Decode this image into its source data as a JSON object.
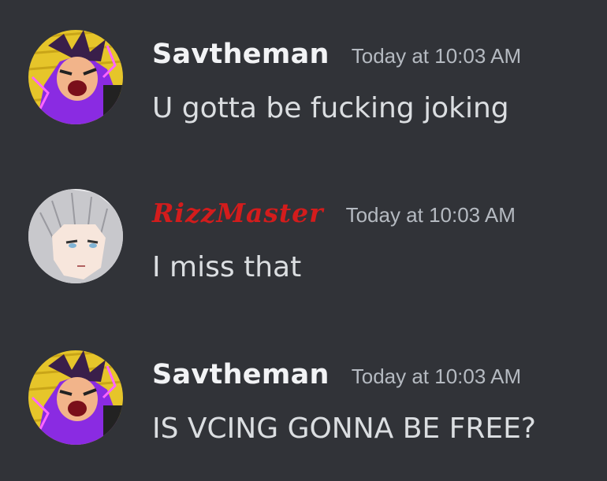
{
  "messages": [
    {
      "username": "Savtheman",
      "timestamp": "Today at 10:03 AM",
      "content": "U gotta be fucking joking",
      "avatar_icon": "anime-character-avatar"
    },
    {
      "username": "RizzMaster",
      "username_color": "#d31c1c",
      "timestamp": "Today at 10:03 AM",
      "content": "I miss that",
      "avatar_icon": "anime-character-avatar"
    },
    {
      "username": "Savtheman",
      "timestamp": "Today at 10:03 AM",
      "content": "IS VCING GONNA BE FREE?",
      "avatar_icon": "anime-character-avatar"
    }
  ],
  "colors": {
    "background": "#313338",
    "username": "#f2f3f5",
    "timestamp": "#b5bac1",
    "message_text": "#dbdee1"
  }
}
